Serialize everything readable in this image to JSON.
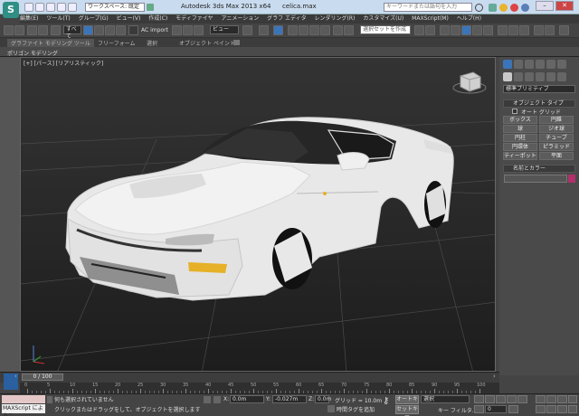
{
  "app": {
    "logo_letter": "S",
    "workspace": "ワークスペース: 既定",
    "title": "Autodesk 3ds Max  2013 x64",
    "filename": "celica.max",
    "search_placeholder": "キーワードまたは語句を入力"
  },
  "menu": [
    "編集(E)",
    "ツール(T)",
    "グループ(G)",
    "ビュー(V)",
    "作成(C)",
    "モディファイヤ",
    "アニメーション",
    "グラフ エディタ",
    "レンダリング(R)",
    "カスタマイズ(U)",
    "MAXScript(M)",
    "ヘルプ(H)"
  ],
  "toolbar": {
    "selection_filter": "すべて",
    "ac_import": "AC import",
    "ref_coord": "ビュー",
    "named_selection": "選択セットを作成"
  },
  "ribbon": {
    "tabs": [
      "グラファイト モデリング ツール",
      "フリーフォーム",
      "選択",
      "オブジェクト ペイント"
    ],
    "polygon_label": "ポリゴン モデリング"
  },
  "viewport": {
    "label": "[+] [パース] [リアリスティック]"
  },
  "command_panel": {
    "category": "標準プリミティブ",
    "object_type_header": "オブジェクト タイプ",
    "autogrid": "オート グリッド",
    "buttons": [
      "ボックス",
      "円錐",
      "球",
      "ジオ球",
      "円柱",
      "チューブ",
      "円環体",
      "ピラミッド",
      "ティーポット",
      "平面"
    ],
    "name_color_header": "名前とカラー",
    "color": "#b1306a"
  },
  "timeline": {
    "frame": "0 / 100",
    "ticks": [
      "0",
      "5",
      "10",
      "15",
      "20",
      "25",
      "30",
      "35",
      "40",
      "45",
      "50",
      "55",
      "60",
      "65",
      "70",
      "75",
      "80",
      "85",
      "90",
      "95",
      "100"
    ]
  },
  "status": {
    "maxscript": "MAXScript にようこ",
    "line1": "何も選択されていません",
    "line2": "クリックまたはドラッグをして、オブジェクトを選択します",
    "x_label": "X:",
    "x_value": "0.0m",
    "y_label": "Y:",
    "y_value": "-0.027m",
    "z_label": "Z:",
    "z_value": "0.0m",
    "grid": "グリッド = 10.0m",
    "add_time_tag": "時間タグを追加",
    "autokey": "オートキー",
    "setkey": "セットキー",
    "selection_dropdown": "選択",
    "key_filter": "キー フィルタ...",
    "frame_field": "0"
  }
}
